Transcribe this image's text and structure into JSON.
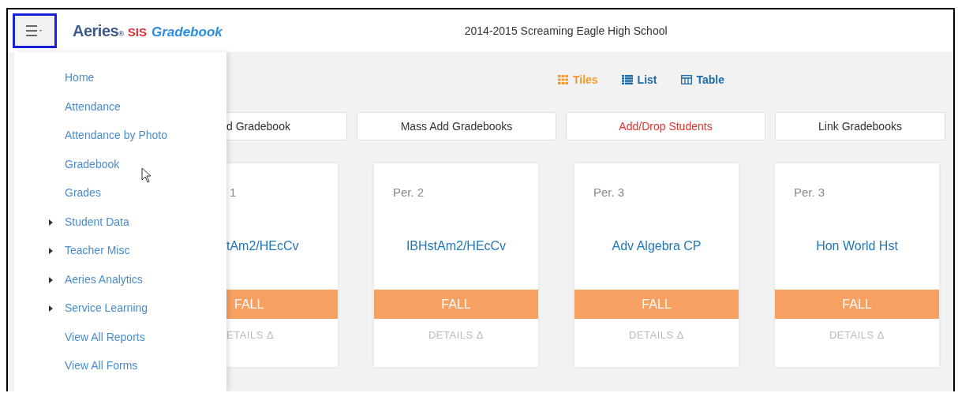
{
  "header": {
    "brand": "Aeries",
    "brand_mark": "®",
    "product": "SIS",
    "module": "Gradebook",
    "school": "2014-2015 Screaming Eagle High School"
  },
  "menu": [
    {
      "label": "Home",
      "expandable": false
    },
    {
      "label": "Attendance",
      "expandable": false
    },
    {
      "label": "Attendance by Photo",
      "expandable": false
    },
    {
      "label": "Gradebook",
      "expandable": false
    },
    {
      "label": "Grades",
      "expandable": false
    },
    {
      "label": "Student Data",
      "expandable": true
    },
    {
      "label": "Teacher Misc",
      "expandable": true
    },
    {
      "label": "Aeries Analytics",
      "expandable": true
    },
    {
      "label": "Service Learning",
      "expandable": true
    },
    {
      "label": "View All Reports",
      "expandable": false
    },
    {
      "label": "View All Forms",
      "expandable": false
    }
  ],
  "views": [
    {
      "label": "Tiles",
      "kind": "tiles",
      "selected": true
    },
    {
      "label": "List",
      "kind": "list",
      "selected": false
    },
    {
      "label": "Table",
      "kind": "table",
      "selected": false
    }
  ],
  "actions": [
    {
      "label": "d Gradebook",
      "highlighted": false
    },
    {
      "label": "Mass Add Gradebooks",
      "highlighted": false
    },
    {
      "label": "Add/Drop Students",
      "highlighted": true
    },
    {
      "label": "Link Gradebooks",
      "highlighted": false
    }
  ],
  "gradebooks": [
    {
      "period": "1",
      "name": "tAm2/HEcCv",
      "term": "FALL",
      "details": "ETAILS Δ"
    },
    {
      "period": "Per. 2",
      "name": "IBHstAm2/HEcCv",
      "term": "FALL",
      "details": "DETAILS Δ"
    },
    {
      "period": "Per. 3",
      "name": "Adv Algebra CP",
      "term": "FALL",
      "details": "DETAILS Δ"
    },
    {
      "period": "Per. 3",
      "name": "Hon World Hst",
      "term": "FALL",
      "details": "DETAILS Δ"
    }
  ]
}
